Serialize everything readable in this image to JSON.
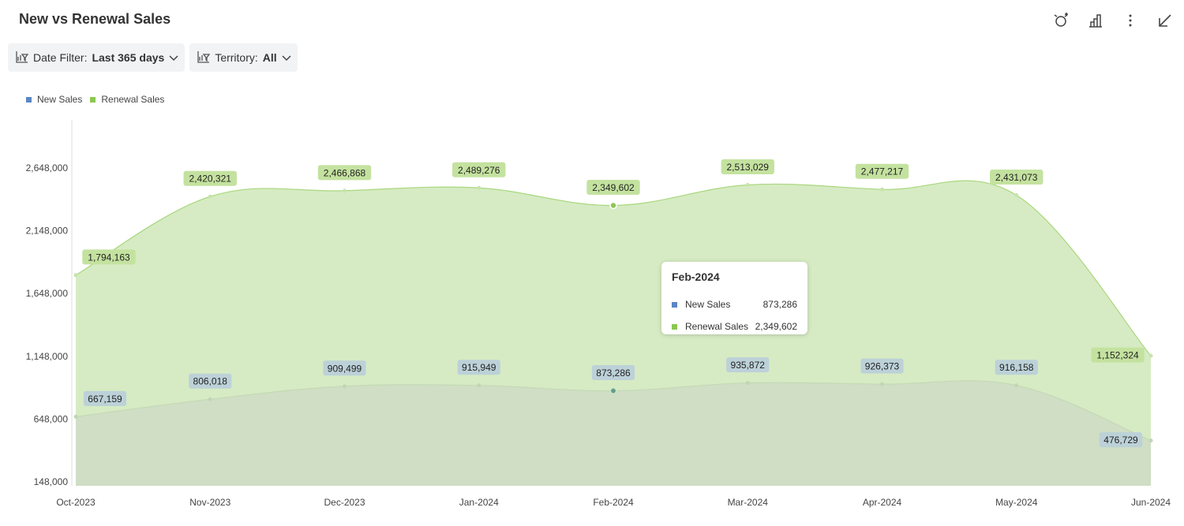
{
  "header": {
    "title": "New vs Renewal Sales"
  },
  "toolbar": {
    "icons": [
      "alarm-plus-icon",
      "bar-chart-icon",
      "more-vertical-icon",
      "collapse-arrow-icon"
    ]
  },
  "filters": [
    {
      "label": "Date Filter:",
      "value": "Last 365 days"
    },
    {
      "label": "Territory:",
      "value": "All"
    }
  ],
  "colors": {
    "new_sales": "#5b87c5",
    "renewal_sales": "#8cc751",
    "renewal_fill": "#d6ebc3",
    "new_fill": "#cfdec4"
  },
  "tooltip": {
    "title": "Feb-2024",
    "rows": [
      {
        "label": "New Sales",
        "value": "873,286"
      },
      {
        "label": "Renewal Sales",
        "value": "2,349,602"
      }
    ]
  },
  "chart_data": {
    "type": "area",
    "categories": [
      "Oct-2023",
      "Nov-2023",
      "Dec-2023",
      "Jan-2024",
      "Feb-2024",
      "Mar-2024",
      "Apr-2024",
      "May-2024",
      "Jun-2024"
    ],
    "series": [
      {
        "name": "New Sales",
        "values": [
          667159,
          806018,
          909499,
          915949,
          873286,
          935872,
          926373,
          916158,
          476729
        ],
        "labels": [
          "667,159",
          "806,018",
          "909,499",
          "915,949",
          "873,286",
          "935,872",
          "926,373",
          "916,158",
          "476,729"
        ]
      },
      {
        "name": "Renewal Sales",
        "values": [
          1794163,
          2420321,
          2466868,
          2489276,
          2349602,
          2513029,
          2477217,
          2431073,
          1152324
        ],
        "labels": [
          "1,794,163",
          "2,420,321",
          "2,466,868",
          "2,489,276",
          "2,349,602",
          "2,513,029",
          "2,477,217",
          "2,431,073",
          "1,152,324"
        ]
      }
    ],
    "yticks": [
      148000,
      648000,
      1148000,
      1648000,
      2148000,
      2648000
    ],
    "ytick_labels": [
      "148,000",
      "648,000",
      "1,148,000",
      "1,648,000",
      "2,148,000",
      "2,648,000"
    ],
    "ylim": [
      148000,
      3048000
    ],
    "legend": "top-left",
    "grid": false,
    "highlighted_category": "Feb-2024"
  }
}
